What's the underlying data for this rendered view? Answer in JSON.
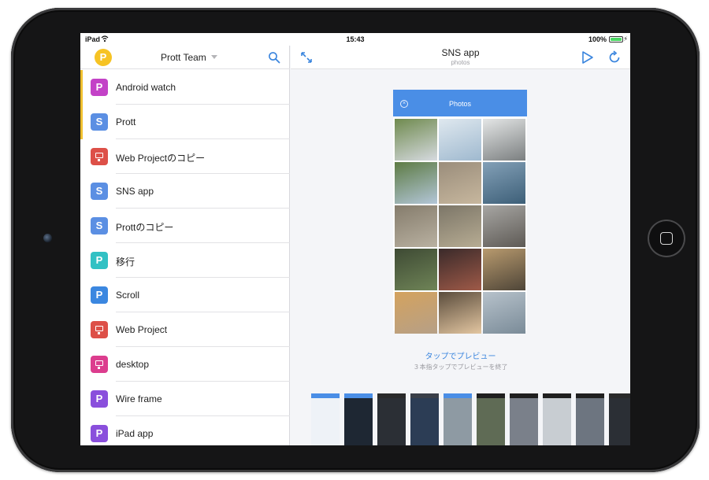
{
  "status": {
    "device": "iPad",
    "time": "15:43",
    "battery": "100%"
  },
  "team": {
    "logo_letter": "P",
    "name": "Prott Team"
  },
  "projects": [
    {
      "name": "Android watch",
      "icon": "P",
      "color": "#c342c7",
      "active": true
    },
    {
      "name": "Prott",
      "icon": "S",
      "color": "#5b8fe3",
      "active": true
    },
    {
      "name": "Web Projectのコピー",
      "icon": "monitor-icon",
      "color": "#dd5048",
      "active": false
    },
    {
      "name": "SNS app",
      "icon": "S",
      "color": "#5b8fe3",
      "active": false
    },
    {
      "name": "Prottのコピー",
      "icon": "S",
      "color": "#5b8fe3",
      "active": false
    },
    {
      "name": "移行",
      "icon": "P",
      "color": "#31c1c4",
      "active": false
    },
    {
      "name": "Scroll",
      "icon": "P",
      "color": "#3b87e0",
      "active": false
    },
    {
      "name": "Web Project",
      "icon": "monitor-icon",
      "color": "#dd5048",
      "active": false
    },
    {
      "name": "desktop",
      "icon": "monitor-icon",
      "color": "#dc3d8e",
      "active": false
    },
    {
      "name": "Wire frame",
      "icon": "P",
      "color": "#8a4fdc",
      "active": false
    },
    {
      "name": "iPad app",
      "icon": "P",
      "color": "#8a4fdc",
      "active": false
    }
  ],
  "screen": {
    "title": "SNS app",
    "subtitle": "photos",
    "phone_title": "Photos",
    "photos": [
      [
        "#6f8a4e",
        "#d6dae0"
      ],
      [
        "#dfe8ef",
        "#9fb9cf"
      ],
      [
        "#e4e6e6",
        "#7b7f80"
      ],
      [
        "#5d7b44",
        "#b3c6d8"
      ],
      [
        "#9a8d7b",
        "#c7b79e"
      ],
      [
        "#83a0b7",
        "#3d5f78"
      ],
      [
        "#857c6c",
        "#b9b1a1"
      ],
      [
        "#7c7668",
        "#b7ac93"
      ],
      [
        "#a7a6a3",
        "#5e5a55"
      ],
      [
        "#3e4a34",
        "#6f8457"
      ],
      [
        "#3a2a2a",
        "#9f5a48"
      ],
      [
        "#b89a6e",
        "#4e4538"
      ],
      [
        "#d4a25e",
        "#b6a087"
      ],
      [
        "#5a4c3c",
        "#e3c6a1"
      ],
      [
        "#b7c2cb",
        "#7a8b98"
      ]
    ],
    "tap_preview": "タップでプレビュー",
    "tap_end": "３本指タップでプレビューを終了"
  },
  "thumbnails": [
    {
      "bar": "#4a8ee6",
      "body": "#eef2f7"
    },
    {
      "bar": "#4a8ee6",
      "body": "#1e2733"
    },
    {
      "bar": "#2a2a2a",
      "body": "#2b2f35"
    },
    {
      "bar": "#3a3f48",
      "body": "#2c3d55"
    },
    {
      "bar": "#4a8ee6",
      "body": "#8e9aa3"
    },
    {
      "bar": "#1f1f1f",
      "body": "#5f6b55"
    },
    {
      "bar": "#1f1f1f",
      "body": "#7a808a"
    },
    {
      "bar": "#1f1f1f",
      "body": "#c8cdd2"
    },
    {
      "bar": "#1f1f1f",
      "body": "#6d7580"
    },
    {
      "bar": "#2a2a2a",
      "body": "#2b2f35"
    }
  ]
}
